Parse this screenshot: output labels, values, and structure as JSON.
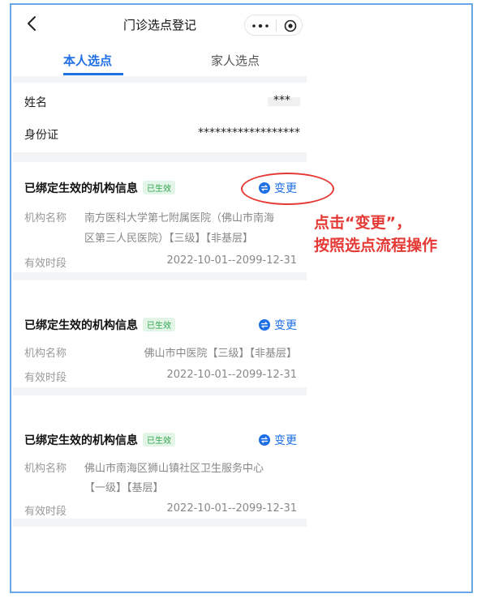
{
  "navbar": {
    "title": "门诊选点登记"
  },
  "tabs": {
    "active": "本人选点",
    "inactive": "家人选点"
  },
  "personal": {
    "name_label": "姓名",
    "name_value": "***",
    "id_label": "身份证",
    "id_value": "******************"
  },
  "cards": [
    {
      "header": "已绑定生效的机构信息",
      "badge": "已生效",
      "change_label": "变更",
      "org_label": "机构名称",
      "org_line1": "南方医科大学第七附属医院（佛山市南海",
      "org_line2": "区第三人民医院）【三级】【非基层】",
      "period_label": "有效时段",
      "period_value": "2022-10-01--2099-12-31"
    },
    {
      "header": "已绑定生效的机构信息",
      "badge": "已生效",
      "change_label": "变更",
      "org_label": "机构名称",
      "org_line1": "佛山市中医院【三级】【非基层】",
      "period_label": "有效时段",
      "period_value": "2022-10-01--2099-12-31"
    },
    {
      "header": "已绑定生效的机构信息",
      "badge": "已生效",
      "change_label": "变更",
      "org_label": "机构名称",
      "org_line1": "佛山市南海区狮山镇社区卫生服务中心",
      "org_line2": "【一级】【基层】",
      "period_label": "有效时段",
      "period_value": "2022-10-01--2099-12-31"
    }
  ],
  "annotation": {
    "line1": "点击“变更”，",
    "line2": "按照选点流程操作"
  },
  "colors": {
    "accent": "#1f6fe6",
    "badge_green": "#2fa44f",
    "annotation_red": "#e53935"
  },
  "icons": [
    "back-icon",
    "more-icon",
    "target-icon",
    "change-icon"
  ]
}
